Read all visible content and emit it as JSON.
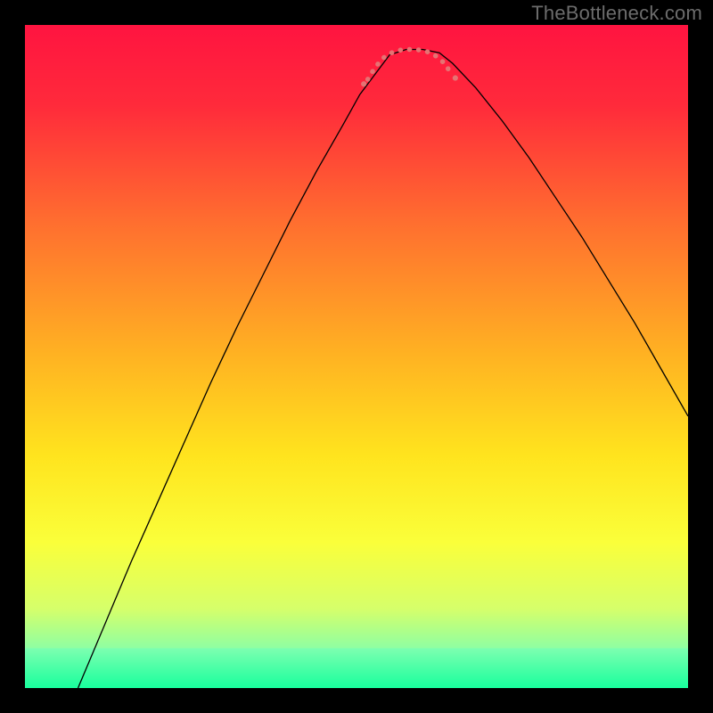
{
  "watermark": "TheBottleneck.com",
  "chart_data": {
    "type": "line",
    "title": "",
    "xlabel": "",
    "ylabel": "",
    "xlim": [
      0,
      100
    ],
    "ylim": [
      0,
      100
    ],
    "gradient_stops": [
      {
        "offset": 0.0,
        "color": "#ff1440"
      },
      {
        "offset": 0.12,
        "color": "#ff2a3b"
      },
      {
        "offset": 0.3,
        "color": "#ff6f2f"
      },
      {
        "offset": 0.5,
        "color": "#ffb322"
      },
      {
        "offset": 0.65,
        "color": "#ffe41e"
      },
      {
        "offset": 0.78,
        "color": "#faff3a"
      },
      {
        "offset": 0.88,
        "color": "#d6ff6a"
      },
      {
        "offset": 0.955,
        "color": "#7dffb0"
      },
      {
        "offset": 1.0,
        "color": "#18ff9d"
      }
    ],
    "bottom_band": {
      "y_start": 94.0,
      "y_end": 100.0,
      "color_top": "#7dffb0",
      "color_bottom": "#18ff9d"
    },
    "series": [
      {
        "name": "bottleneck-curve",
        "color": "#000000",
        "width": 1.3,
        "x": [
          8.0,
          12,
          16,
          20,
          24,
          28,
          32,
          36,
          40,
          44,
          48,
          50.5,
          53.5,
          55.0,
          57.5,
          60.0,
          62.5,
          64.5,
          68,
          72,
          76,
          80,
          84,
          88,
          92,
          96,
          100
        ],
        "y": [
          0.0,
          9.5,
          19,
          28,
          37,
          46,
          54.5,
          62.5,
          70.5,
          78,
          85,
          89.5,
          93.5,
          95.5,
          96.3,
          96.3,
          95.8,
          94.2,
          90.5,
          85.5,
          80,
          74,
          68,
          61.5,
          55,
          48,
          41
        ]
      }
    ],
    "flat_segment": {
      "name": "optimal-range",
      "color": "#e57373",
      "width": 5.5,
      "dash": "0.2 10",
      "cap": "round",
      "points": [
        {
          "x": 51.7,
          "y": 91.8
        },
        {
          "x": 52.8,
          "y": 93.6
        },
        {
          "x": 54.0,
          "y": 95.0
        },
        {
          "x": 55.3,
          "y": 95.8
        },
        {
          "x": 56.6,
          "y": 96.2
        },
        {
          "x": 58.0,
          "y": 96.3
        },
        {
          "x": 59.3,
          "y": 96.25
        },
        {
          "x": 60.6,
          "y": 96.0
        },
        {
          "x": 62.0,
          "y": 95.3
        },
        {
          "x": 63.3,
          "y": 94.2
        },
        {
          "x": 64.3,
          "y": 92.6
        }
      ],
      "endcaps": [
        {
          "x": 51.1,
          "y": 91.1,
          "r": 3.1
        },
        {
          "x": 64.9,
          "y": 92.0,
          "r": 3.1
        }
      ]
    }
  }
}
